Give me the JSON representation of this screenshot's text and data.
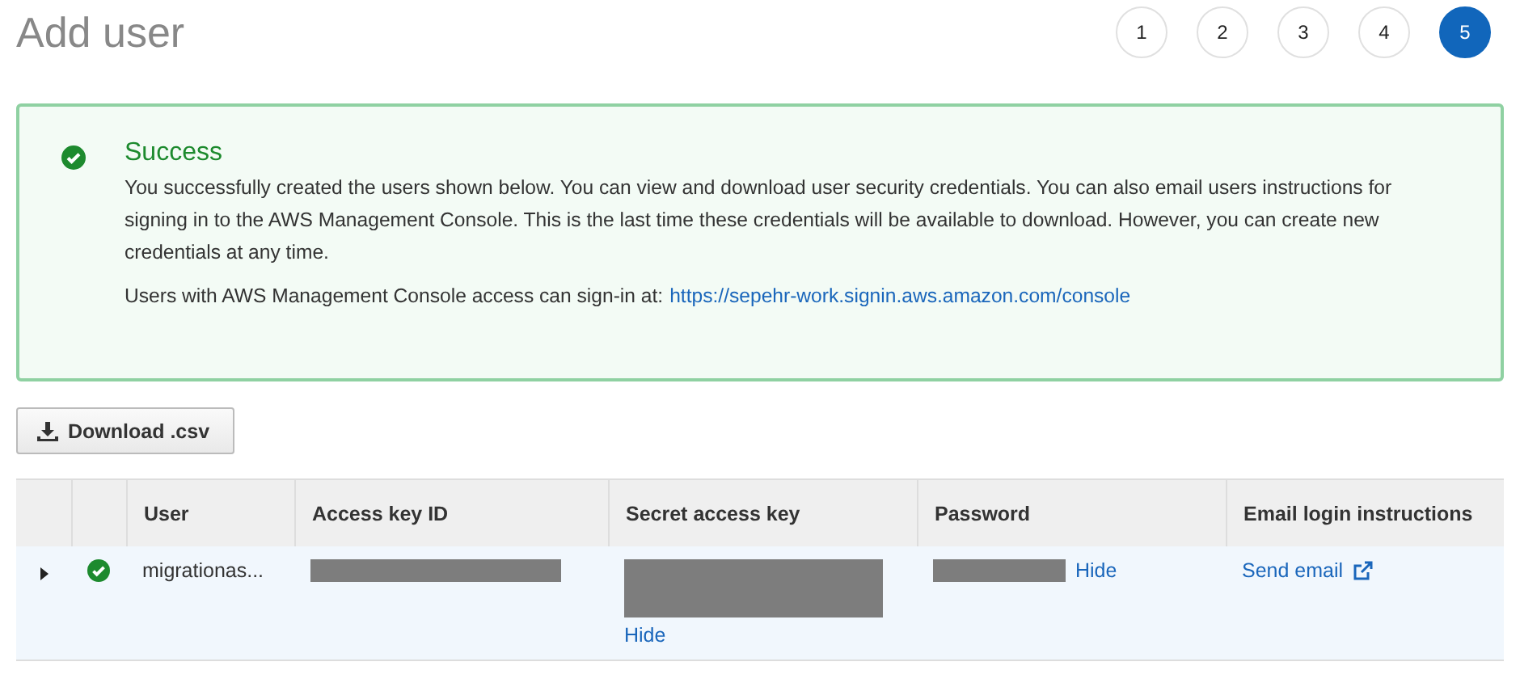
{
  "page": {
    "title": "Add user"
  },
  "steps": [
    {
      "label": "1",
      "selected": false
    },
    {
      "label": "2",
      "selected": false
    },
    {
      "label": "3",
      "selected": false
    },
    {
      "label": "4",
      "selected": false
    },
    {
      "label": "5",
      "selected": true
    }
  ],
  "alert": {
    "title": "Success",
    "message": "You successfully created the users shown below. You can view and download user security credentials. You can also email users instructions for signing in to the AWS Management Console. This is the last time these credentials will be available to download. However, you can create new credentials at any time.",
    "signin_text": "Users with AWS Management Console access can sign-in at:",
    "signin_link": "https://sepehr-work.signin.aws.amazon.com/console"
  },
  "download_button": "Download .csv",
  "table": {
    "columns": [
      "User",
      "Access key ID",
      "Secret access key",
      "Password",
      "Email login instructions"
    ],
    "rows": [
      {
        "expanded": false,
        "user": "migrationas...",
        "secret_toggle": "Hide",
        "password_toggle": "Hide",
        "email_link": "Send email"
      }
    ]
  }
}
